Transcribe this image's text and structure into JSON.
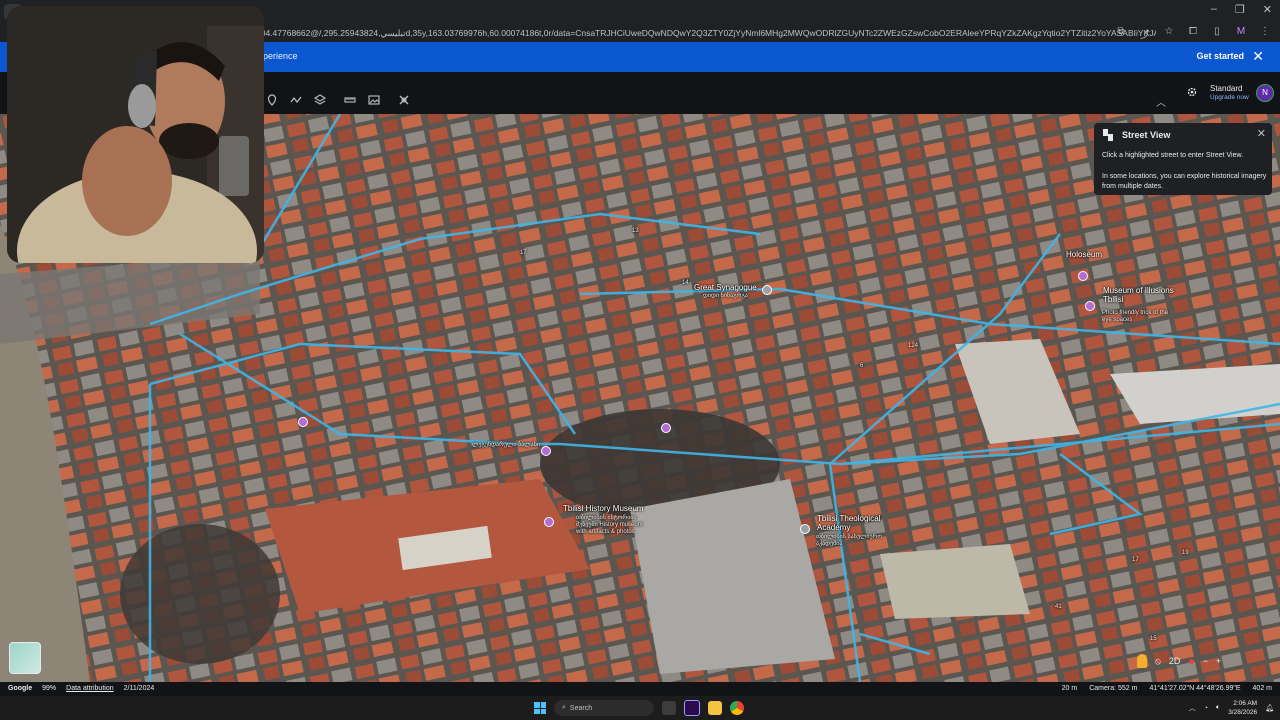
{
  "browser": {
    "url": "104.47768662@/,تبليسي,295.25943824d,35y,163.03769976h,60.00074186t,0r/data=CnsaTRJHCiUweDQwNDQwY2Q3ZTY0ZjYyNml6MHg2MWQwODRlZGUyNTc2ZWEzGZswCobO2ERAleeYPRqYZkZAKgzYqtio2YTZitiz2YoYASABIiYKJAm6D8gdHjs5QBFBa62KWDE4QBkUmRO56KZHQCEKuy_w8..."
  },
  "banner": {
    "text": "perience",
    "cta": "Get started",
    "close": "✕"
  },
  "header": {
    "plan_title": "Standard",
    "plan_subtitle": "Upgrade now",
    "avatar_initial": "N"
  },
  "street_view": {
    "title": "Street View",
    "line1": "Click a highlighted street to enter Street View.",
    "line2": "In some locations, you can explore historical imagery from multiple dates.",
    "close": "✕"
  },
  "places": [
    {
      "name": "Great Synagogue",
      "sub": "დიდი სინაგოგა"
    },
    {
      "name": "Holoseum",
      "sub": ""
    },
    {
      "name": "Museum of Illusions Tbilisi",
      "sub": "Photo friendly trick of the eye spaces"
    },
    {
      "name": "Tbilisi History Museum",
      "sub": "თბილისის ისტორიის მუზეუმი History museum with artifacts & photos"
    },
    {
      "name": "Tbilisi Theological Academy",
      "sub": "თბილისის სასულიერო აკადემია"
    },
    {
      "name": "",
      "sub": "ლეგენდარული ბალახი"
    }
  ],
  "map_numbers": [
    "13",
    "14",
    "17",
    "124",
    "6",
    "19",
    "17",
    "41",
    "15"
  ],
  "controls": {
    "mode": "2D"
  },
  "status": {
    "brand": "Google",
    "progress": "99%",
    "attribution": "Data attribution",
    "date": "2/11/2024",
    "scale": "20 m",
    "camera": "Camera: 552 m",
    "coords": "41°41'27.02\"N 44°48'26.99\"E",
    "elevation": "402 m"
  },
  "taskbar": {
    "search_placeholder": "Search",
    "time": "2:06 AM",
    "date": "3/28/2026"
  }
}
